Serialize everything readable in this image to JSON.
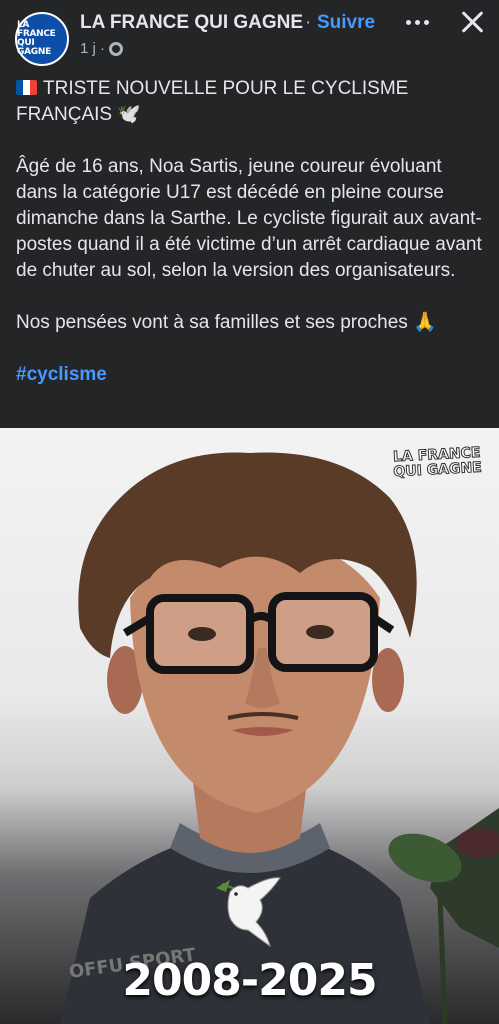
{
  "header": {
    "avatar_text_line1": "LA FRANCE",
    "avatar_text_line2": "QUI GAGNE",
    "page_name": "LA FRANCE QUI GAGNE",
    "separator": "·",
    "follow_label": "Suivre",
    "timestamp": "1 j ·",
    "globe_icon": "globe-icon",
    "more_icon": "more-dots-icon",
    "close_icon": "close-icon"
  },
  "post": {
    "title": "TRISTE NOUVELLE POUR LE CYCLISME FRANÇAIS 🕊️",
    "body": "Âgé de 16 ans, Noa Sartis, jeune coureur évoluant dans la catégorie U17 est décédé en pleine course dimanche dans la Sarthe. Le cycliste figurait aux avant-postes quand il a été victime d’un arrêt cardiaque avant de chuter au sol, selon la version des organisateurs.",
    "thoughts": "Nos pensées vont à sa familles et ses proches 🙏",
    "hashtag": "#cyclisme"
  },
  "image": {
    "watermark_line1": "LA FRANCE",
    "watermark_line2": "QUI GAGNE",
    "years": "2008-2025",
    "jersey_text": "OFFU SPORT"
  },
  "colors": {
    "background": "#242526",
    "text": "#e4e6eb",
    "link": "#4599ff",
    "muted": "#b0b3b8"
  }
}
